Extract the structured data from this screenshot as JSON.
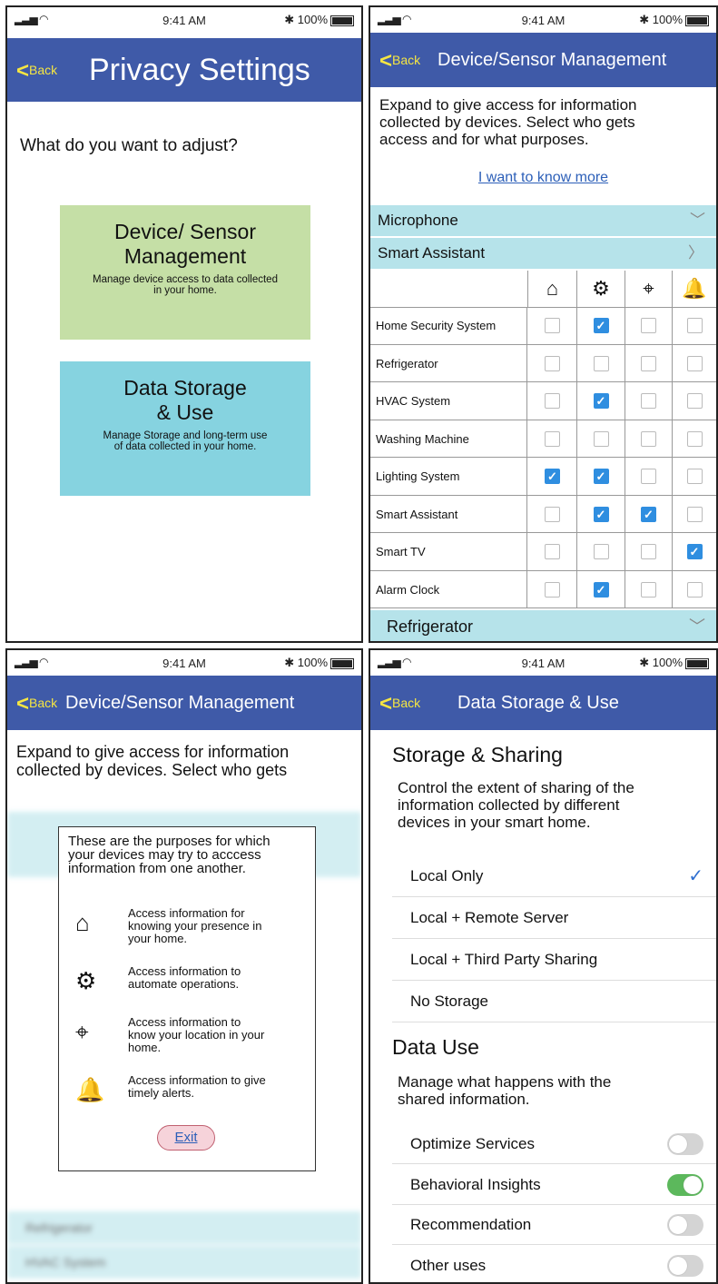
{
  "status": {
    "time": "9:41 AM",
    "battery": "100%"
  },
  "common": {
    "back_label": "Back"
  },
  "panel1": {
    "title": "Privacy Settings",
    "question": "What do you want to adjust?",
    "card1": {
      "title": "Device/ Sensor Management",
      "title_line1": "Device/ Sensor",
      "title_line2": "Management",
      "desc_line1": "Manage device access to data collected",
      "desc_line2": "in your home.",
      "color": "#c5dfa6"
    },
    "card2": {
      "title_line1": "Data Storage",
      "title_line2": "& Use",
      "desc_line1": "Manage Storage and long-term use",
      "desc_line2": "of data collected in your home.",
      "color": "#86d3e0"
    }
  },
  "panel2": {
    "title": "Device/Sensor Management",
    "intro_line1": "Expand to give access for information",
    "intro_line2": "collected by devices. Select who gets",
    "intro_line3": "access and for what purposes.",
    "link": "I want to know more",
    "section_microphone": "Microphone",
    "section_smart_assistant": "Smart Assistant",
    "section_refrigerator": "Refrigerator",
    "column_icons": [
      "presence-home-icon",
      "gears-icon",
      "location-home-icon",
      "bell-icon"
    ],
    "rows": [
      {
        "label": "Home Security System",
        "checks": [
          false,
          true,
          false,
          false
        ]
      },
      {
        "label": "Refrigerator",
        "checks": [
          false,
          false,
          false,
          false
        ]
      },
      {
        "label": "HVAC System",
        "checks": [
          false,
          true,
          false,
          false
        ]
      },
      {
        "label": "Washing Machine",
        "checks": [
          false,
          false,
          false,
          false
        ]
      },
      {
        "label": "Lighting System",
        "checks": [
          true,
          true,
          false,
          false
        ]
      },
      {
        "label": "Smart Assistant",
        "checks": [
          false,
          true,
          true,
          false
        ]
      },
      {
        "label": "Smart TV",
        "checks": [
          false,
          false,
          false,
          true
        ]
      },
      {
        "label": "Alarm Clock",
        "checks": [
          false,
          true,
          false,
          false
        ]
      }
    ],
    "accent_color": "#b6e3ea"
  },
  "panel3": {
    "title": "Device/Sensor Management",
    "intro_line1": "Expand to give access for information",
    "intro_line2": "collected by devices. Select who gets",
    "popup": {
      "intro_line1": "These are the purposes for which",
      "intro_line2": "your devices may try to acccess",
      "intro_line3": "information from one another.",
      "items": [
        {
          "icon": "presence-home-icon",
          "line1": "Access  information for",
          "line2": "knowing your presence in",
          "line3": "your home."
        },
        {
          "icon": "gears-icon",
          "line1": "Access information to",
          "line2": "automate operations.",
          "line3": ""
        },
        {
          "icon": "location-home-icon",
          "line1": "Access  information to",
          "line2": "know your location in your",
          "line3": "home."
        },
        {
          "icon": "bell-icon",
          "line1": "Access  information to give",
          "line2": "timely alerts.",
          "line3": ""
        }
      ],
      "exit_label": "Exit"
    },
    "blurred_sections": [
      "Refrigerator",
      "HVAC System"
    ]
  },
  "panel4": {
    "title": "Data Storage & Use",
    "storage_heading": "Storage & Sharing",
    "storage_desc_line1": "Control the extent of sharing of the",
    "storage_desc_line2": "information collected by different",
    "storage_desc_line3": "devices in your smart home.",
    "storage_options": [
      {
        "label": "Local Only",
        "selected": true
      },
      {
        "label": "Local + Remote Server",
        "selected": false
      },
      {
        "label": "Local + Third Party Sharing",
        "selected": false
      },
      {
        "label": "No Storage",
        "selected": false
      }
    ],
    "use_heading": "Data Use",
    "use_desc_line1": "Manage what happens with the",
    "use_desc_line2": "shared information.",
    "use_options": [
      {
        "label": "Optimize Services",
        "on": false
      },
      {
        "label": "Behavioral Insights",
        "on": true
      },
      {
        "label": "Recommendation",
        "on": false
      },
      {
        "label": "Other uses",
        "on": false
      }
    ]
  }
}
